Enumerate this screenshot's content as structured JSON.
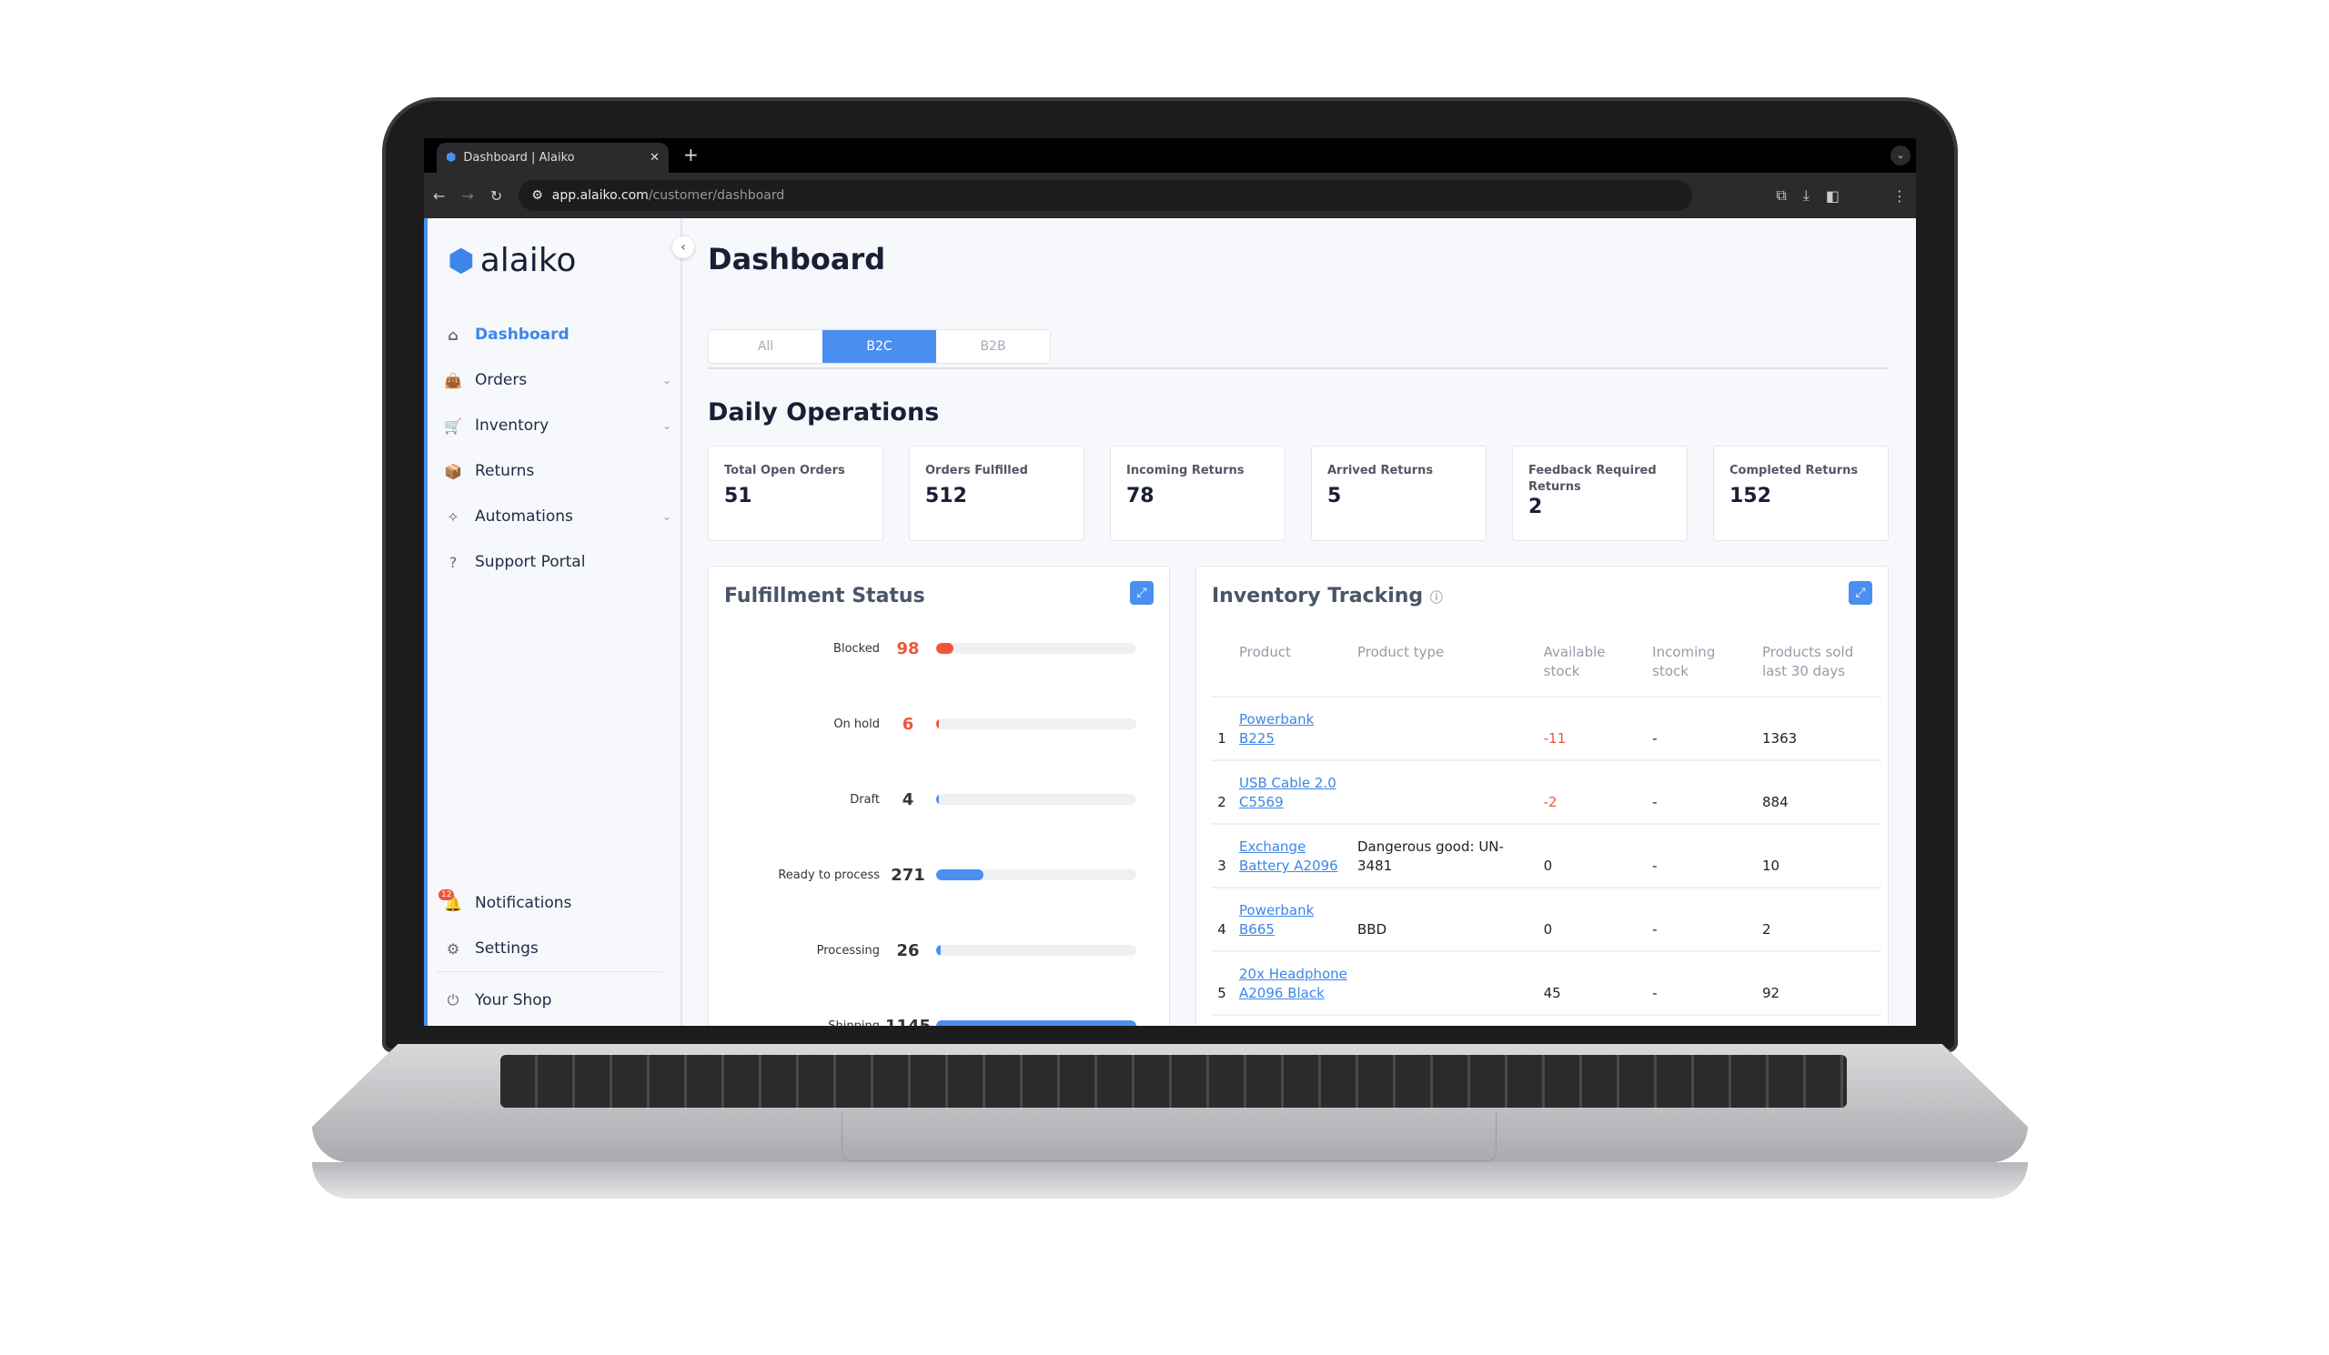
{
  "browser": {
    "tab_title": "Dashboard | Alaiko",
    "url_host": "app.alaiko.com",
    "url_path": "/customer/dashboard"
  },
  "sidebar": {
    "logo": "alaiko",
    "items": [
      {
        "label": "Dashboard",
        "icon": "home-icon",
        "active": true
      },
      {
        "label": "Orders",
        "icon": "bag-icon",
        "dropdown": true
      },
      {
        "label": "Inventory",
        "icon": "cart-icon",
        "dropdown": true
      },
      {
        "label": "Returns",
        "icon": "return-box-icon"
      },
      {
        "label": "Automations",
        "icon": "sparkle-icon",
        "dropdown": true
      },
      {
        "label": "Support Portal",
        "icon": "help-icon"
      }
    ],
    "notifications": {
      "label": "Notifications",
      "count": "12"
    },
    "settings": "Settings",
    "shop": "Your Shop"
  },
  "main": {
    "title": "Dashboard",
    "tabs": [
      "All",
      "B2C",
      "B2B"
    ],
    "active_tab": "B2C",
    "section": "Daily Operations",
    "cards": [
      {
        "label": "Total Open Orders",
        "value": "51"
      },
      {
        "label": "Orders Fulfilled",
        "value": "512"
      },
      {
        "label": "Incoming Returns",
        "value": "78"
      },
      {
        "label": "Arrived Returns",
        "value": "5"
      },
      {
        "label": "Feedback Required Returns",
        "value": "2"
      },
      {
        "label": "Completed Returns",
        "value": "152"
      }
    ]
  },
  "fulfillment": {
    "title": "Fulfillment Status",
    "rows": [
      {
        "label": "Blocked",
        "value": "98",
        "color": "#f0553a"
      },
      {
        "label": "On hold",
        "value": "6",
        "color": "#f0553a"
      },
      {
        "label": "Draft",
        "value": "4",
        "color": "#4a8ff0"
      },
      {
        "label": "Ready to process",
        "value": "271",
        "color": "#4a8ff0"
      },
      {
        "label": "Processing",
        "value": "26",
        "color": "#4a8ff0"
      },
      {
        "label": "Shipping",
        "value": "1145",
        "color": "#4a8ff0"
      }
    ]
  },
  "inventory": {
    "title": "Inventory Tracking",
    "headers": [
      "",
      "Product",
      "Product type",
      "Available stock",
      "Incoming stock",
      "Products sold last 30 days"
    ],
    "rows": [
      [
        "1",
        "Powerbank B225",
        "",
        "-11",
        "-",
        "1363"
      ],
      [
        "2",
        "USB Cable 2.0 C5569",
        "",
        "-2",
        "-",
        "884"
      ],
      [
        "3",
        "Exchange Battery A2096",
        "Dangerous good: UN-3481",
        "0",
        "-",
        "10"
      ],
      [
        "4",
        "Powerbank B665",
        "BBD",
        "0",
        "-",
        "2"
      ],
      [
        "5",
        "20x Headphone A2096 Black",
        "",
        "45",
        "-",
        "92"
      ]
    ]
  },
  "colors": {
    "accent": "#4a8ff0",
    "danger": "#f0553a"
  }
}
